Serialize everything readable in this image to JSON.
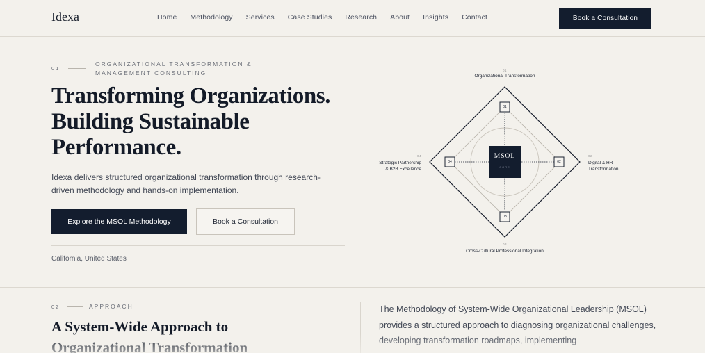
{
  "nav": {
    "logo": "Idexa",
    "links": [
      "Home",
      "Methodology",
      "Services",
      "Case Studies",
      "Research",
      "About",
      "Insights",
      "Contact"
    ],
    "cta": "Book a Consultation"
  },
  "hero": {
    "eyebrow_num": "01",
    "eyebrow": "ORGANIZATIONAL TRANSFORMATION & MANAGEMENT CONSULTING",
    "title_line1": "Transforming Organizations.",
    "title_line2": "Building Sustainable",
    "title_line3": "Performance.",
    "description": "Idexa delivers structured organizational transformation through research-driven methodology and hands-on implementation.",
    "primary_button": "Explore the MSOL Methodology",
    "secondary_button": "Book a Consultation",
    "location": "California, United States"
  },
  "diagram": {
    "center_title": "MSOL",
    "center_sub": "CORE",
    "nodes": [
      {
        "id": "01",
        "label": "Organizational Transformation"
      },
      {
        "id": "02",
        "label_line1": "Digital & HR",
        "label_line2": "Transformation"
      },
      {
        "id": "03",
        "label": "Cross-Cultural Professional Integration"
      },
      {
        "id": "04",
        "label_line1": "Strategic Partnership",
        "label_line2": "& B2B Excellence"
      }
    ],
    "colors": {
      "navy": "#131d2e",
      "line": "#1b2230",
      "ring": "#c9c4bb"
    }
  },
  "approach": {
    "num": "02",
    "eyebrow": "APPROACH",
    "title_line1": "A System-Wide Approach to",
    "title_line2": "Organizational Transformation",
    "body": "The Methodology of System-Wide Organizational Leadership (MSOL) provides a structured approach to diagnosing organizational challenges, developing transformation roadmaps, implementing"
  }
}
